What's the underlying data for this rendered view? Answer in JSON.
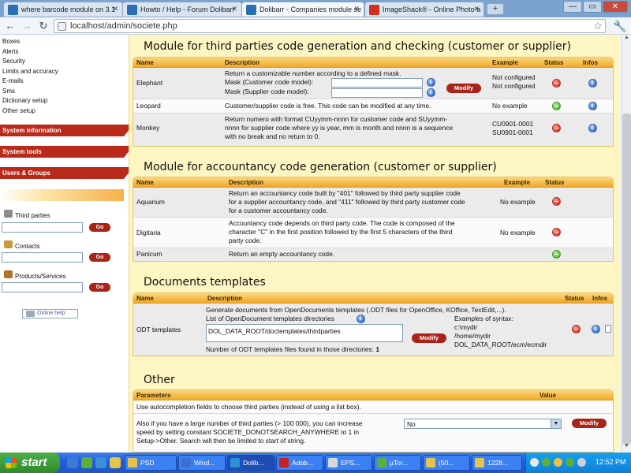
{
  "browser": {
    "tabs": [
      {
        "title": "where barcode module on 3.1",
        "icon_color": "#2d6fb5"
      },
      {
        "title": "Howto / Help - Forum Dolibarr",
        "icon_color": "#2d6fb5"
      },
      {
        "title": "Dolibarr - Companies module se",
        "icon_color": "#2d6fb5"
      },
      {
        "title": "ImageShack® - Online Photo a",
        "icon_color": "#d03020"
      }
    ],
    "new_tab_label": "+",
    "window_buttons": {
      "minimize": "—",
      "maximize": "▭",
      "close": "✕"
    },
    "nav": {
      "back": "←",
      "forward": "→",
      "reload": "↻"
    },
    "url": "localhost/admin/societe.php",
    "star": "☆",
    "wrench": "🔧"
  },
  "leftmenu": {
    "links": [
      "Boxes",
      "Alerts",
      "Security",
      "Limits and accuracy",
      "E-mails",
      "Sms",
      "Dictionary setup",
      "Other setup"
    ],
    "headers": [
      "System information",
      "System tools",
      "Users & Groups"
    ],
    "searches": [
      {
        "label": "Third parties",
        "go": "Go",
        "icon_color": "#8d8d8d"
      },
      {
        "label": "Contacts",
        "go": "Go",
        "icon_color": "#c69c3e"
      },
      {
        "label": "Products/Services",
        "go": "Go",
        "icon_color": "#b3702a"
      }
    ],
    "help": "Online help"
  },
  "sections": {
    "codegen": {
      "title": "Module for third parties code generation and checking (customer or supplier)",
      "headers": {
        "name": "Name",
        "description": "Description",
        "example": "Example",
        "status": "Status",
        "infos": "Infos"
      },
      "elephant": {
        "name": "Elephant",
        "desc1": "Return a customizable number according to a defined mask.",
        "mask_customer": "Mask (Customer code model):",
        "mask_supplier": "Mask (Supplier code model):",
        "modify": "Modify",
        "example1": "Not configured",
        "example2": "Not configured"
      },
      "leopard": {
        "name": "Leopard",
        "desc": "Customer/supplier code is free. This code can be modified at any time.",
        "example": "No example"
      },
      "monkey": {
        "name": "Monkey",
        "desc1": "Return numero with format CUyymm-nnnn for customer code and SUyymm-",
        "desc2": "nnnn for supplier code where yy is year, mm is month and nnnn is a sequence",
        "desc3": "with no break and no return to 0.",
        "example1": "CU0901-0001",
        "example2": "SU0901-0001"
      }
    },
    "accountancy": {
      "title": "Module for accountancy code generation (customer or supplier)",
      "headers": {
        "name": "Name",
        "description": "Description",
        "example": "Example",
        "status": "Status"
      },
      "aquarium": {
        "name": "Aquarium",
        "desc1": "Return an accountancy code built by \"401\" followed by third party supplier code",
        "desc2": "for a supplier accountancy code, and \"411\" followed by third party customer code",
        "desc3": "for a customer accountancy code.",
        "example": "No example"
      },
      "digitaria": {
        "name": "Digitaria",
        "desc1": "Accountancy code depends on third party code. The code is composed of the",
        "desc2": "character \"C\" in the first position followed by the first 5 characters of the third",
        "desc3": "party code.",
        "example": "No example"
      },
      "panicum": {
        "name": "Panicum",
        "desc": "Return an empty accountancy code."
      }
    },
    "documents": {
      "title": "Documents templates",
      "headers": {
        "name": "Name",
        "description": "Description",
        "status": "Status",
        "infos": "Infos"
      },
      "odt": {
        "name": "ODT templates",
        "desc1": "Generate documents from OpenDocuments templates (.ODT files for OpenOffice, KOffice, TextEdit,...).",
        "desc2": "List of OpenDocument templates directories",
        "dir_value": "DOL_DATA_ROOT/doctemplates/thirdparties",
        "modify": "Modify",
        "count_label": "Number of ODT templates files found in those directories:",
        "count": "1",
        "examples_title": "Examples of syntax:",
        "ex1": "c:\\mydir",
        "ex2": "/home/mydir",
        "ex3": "DOL_DATA_ROOT/ecm/ecmdir"
      }
    },
    "other": {
      "title": "Other",
      "headers": {
        "parameters": "Parameters",
        "value": "Value"
      },
      "row1": "Use autocompletion fields to choose third parties (instead of using a list box).",
      "row2_1": "Also if you have a large number of third parties (> 100 000), you can increase",
      "row2_2": "speed by setting constant SOCIETE_DONOTSEARCH_ANYWHERE to 1 in",
      "row2_3": "Setup->Other. Search will then be limited to start of string.",
      "select_value": "No",
      "modify": "Modify"
    }
  },
  "taskbar": {
    "start": "start",
    "tasks": [
      {
        "label": "PSD",
        "icon_color": "#e8c34a"
      },
      {
        "label": "Wind...",
        "icon_color": "#3a6fd0"
      },
      {
        "label": "Dolib...",
        "icon_color": "#2d8fd8"
      },
      {
        "label": "Adob...",
        "icon_color": "#c82020"
      },
      {
        "label": "EPS...",
        "icon_color": "#d8d8d8"
      },
      {
        "label": "µTor...",
        "icon_color": "#5ab03a"
      },
      {
        "label": "(50...",
        "icon_color": "#e8c34a"
      },
      {
        "label": "1228...",
        "icon_color": "#e8c34a"
      }
    ],
    "clock": "12:52 PM"
  }
}
